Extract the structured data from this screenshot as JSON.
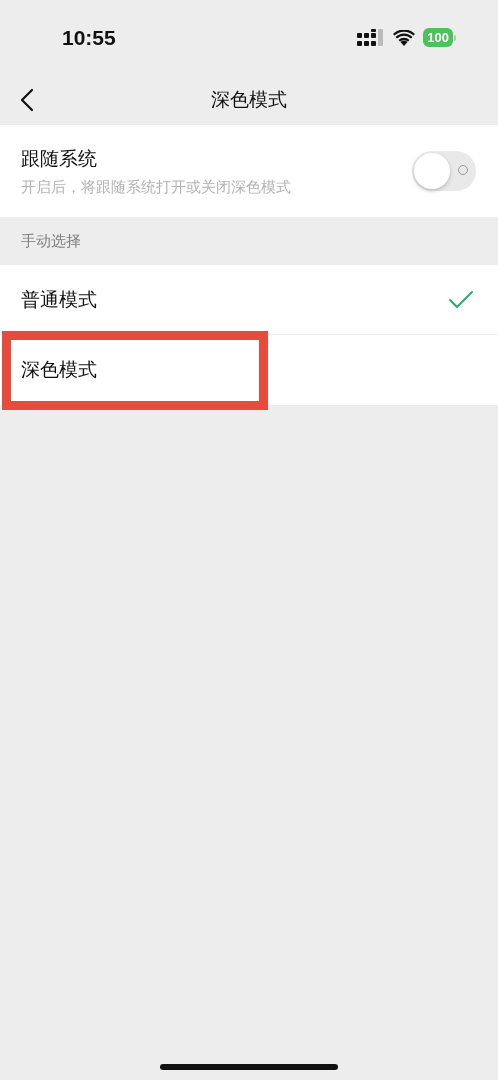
{
  "status_bar": {
    "time": "10:55",
    "battery": "100"
  },
  "nav": {
    "title": "深色模式"
  },
  "follow_system": {
    "label": "跟随系统",
    "description": "开启后，将跟随系统打开或关闭深色模式",
    "on": false
  },
  "section_header": "手动选择",
  "modes": [
    {
      "label": "普通模式",
      "selected": true,
      "highlighted": false
    },
    {
      "label": "深色模式",
      "selected": false,
      "highlighted": true
    }
  ]
}
